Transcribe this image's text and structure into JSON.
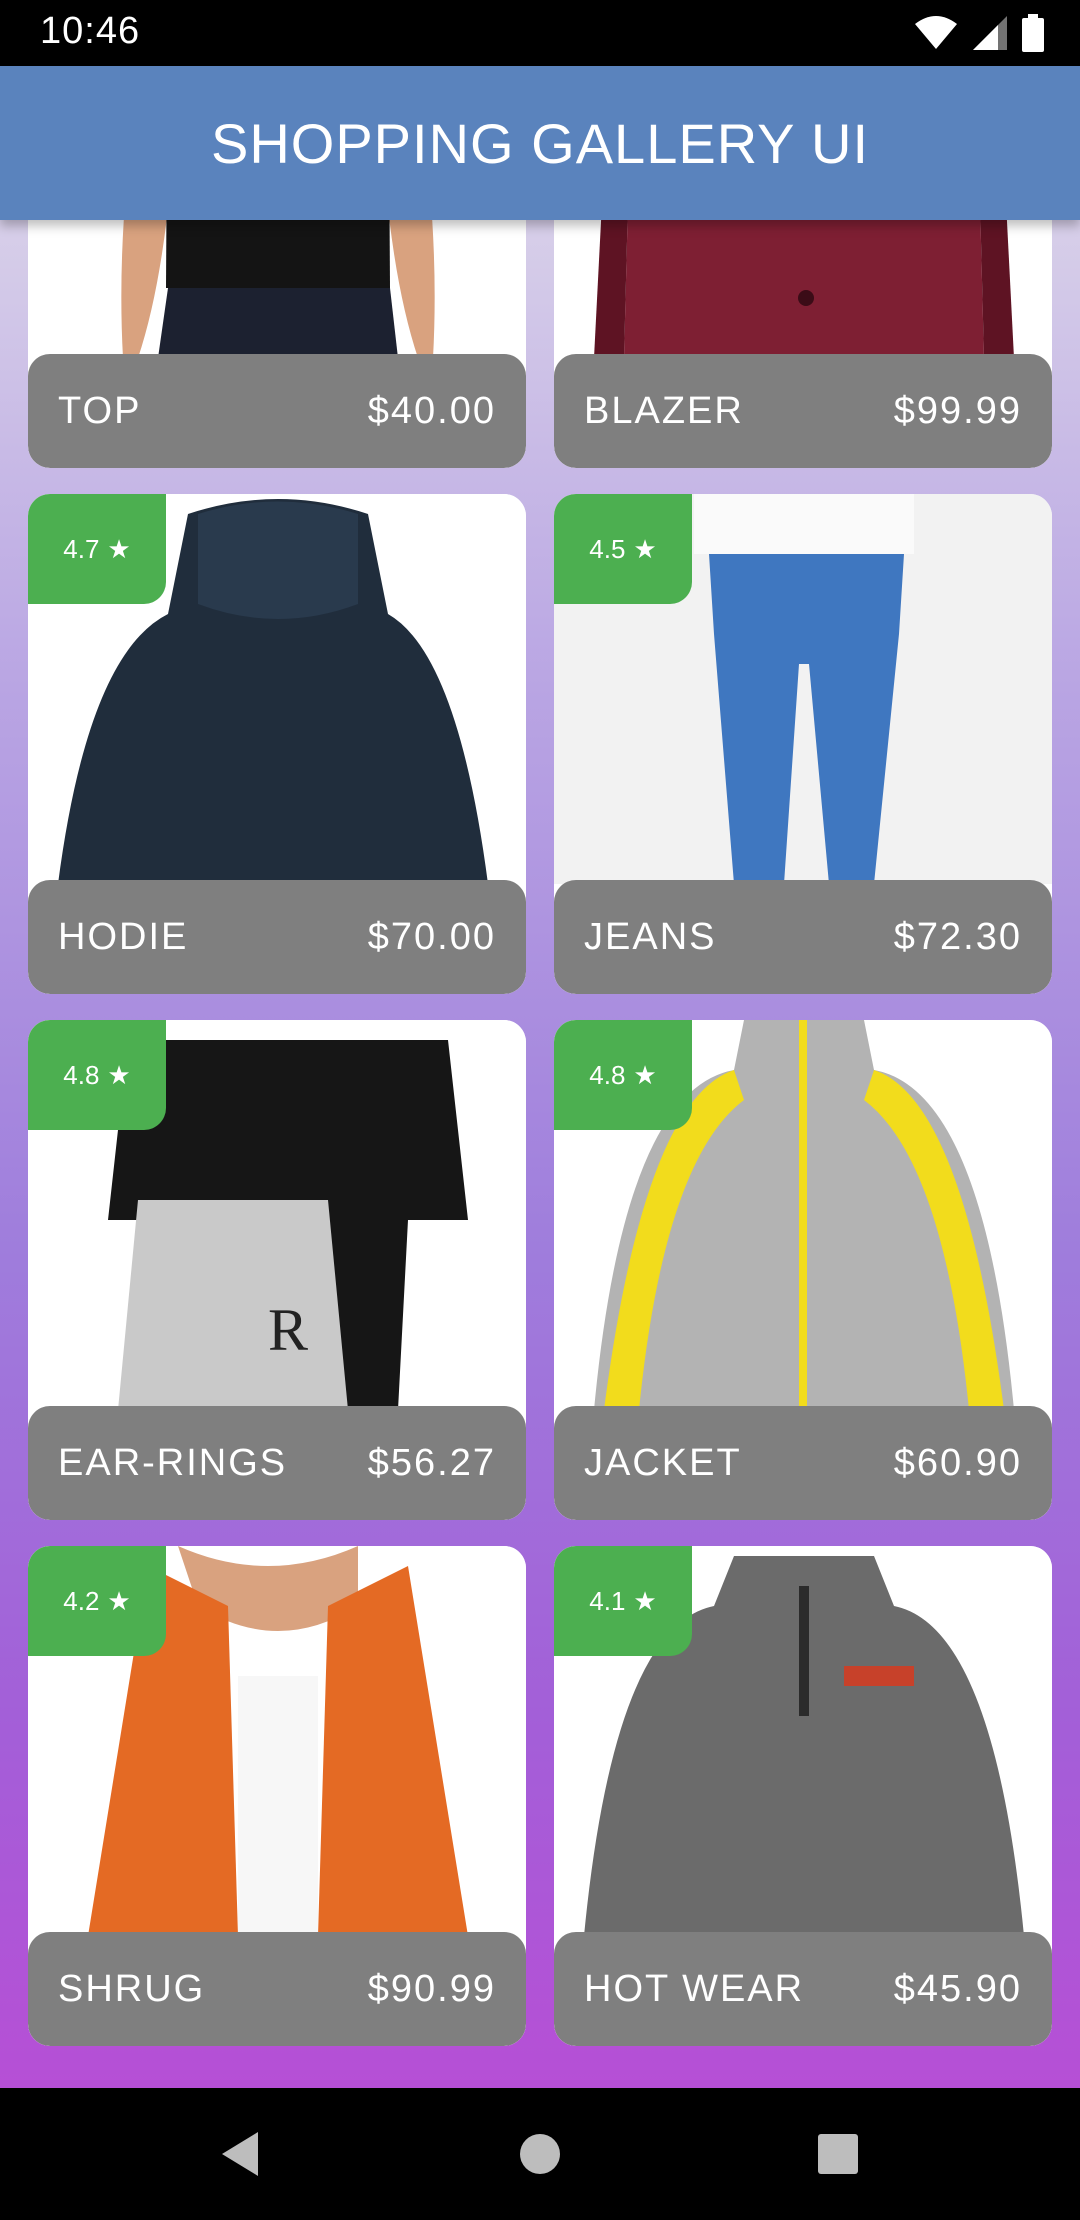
{
  "status_bar": {
    "time": "10:46"
  },
  "app_bar": {
    "title": "SHOPPING GALLERY UI"
  },
  "products": [
    {
      "name": "TOP",
      "price": "$40.00",
      "rating": ""
    },
    {
      "name": "BLAZER",
      "price": "$99.99",
      "rating": ""
    },
    {
      "name": "HODIE",
      "price": "$70.00",
      "rating": "4.7"
    },
    {
      "name": "JEANS",
      "price": "$72.30",
      "rating": "4.5"
    },
    {
      "name": "EAR-RINGS",
      "price": "$56.27",
      "rating": "4.8"
    },
    {
      "name": "JACKET",
      "price": "$60.90",
      "rating": "4.8"
    },
    {
      "name": "SHRUG",
      "price": "$90.99",
      "rating": "4.2"
    },
    {
      "name": "HOT WEAR",
      "price": "$45.90",
      "rating": "4.1"
    }
  ],
  "colors": {
    "app_bar": "#5a83bd",
    "rating_badge": "#4caf50",
    "card_footer": "#7f7f7f"
  }
}
